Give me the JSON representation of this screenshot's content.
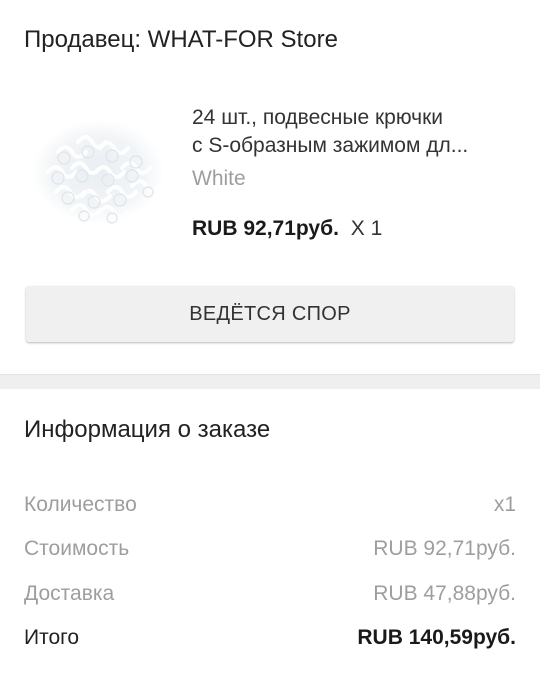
{
  "seller": {
    "title": "Продавец: WHAT-FOR Store"
  },
  "product": {
    "image_name": "s-hooks-product-image",
    "title_line1": "24 шт., подвесные крючки",
    "title_line2": "с S-образным зажимом дл...",
    "variant": "White",
    "price": "RUB 92,71руб.",
    "quantity": "X 1"
  },
  "dispute_button": {
    "label": "ВЕДЁТСЯ СПОР"
  },
  "order_info": {
    "heading": "Информация о заказе",
    "rows": [
      {
        "label": "Количество",
        "value": "x1"
      },
      {
        "label": "Стоимость",
        "value": "RUB 92,71руб."
      },
      {
        "label": "Доставка",
        "value": "RUB 47,88руб."
      },
      {
        "label": "Итого",
        "value": "RUB 140,59руб."
      }
    ]
  },
  "colors": {
    "background": "#ffffff",
    "divider": "#efefef",
    "button_bg": "#f0f0f0",
    "muted_text": "#9e9e9e",
    "primary_text": "#222222"
  }
}
